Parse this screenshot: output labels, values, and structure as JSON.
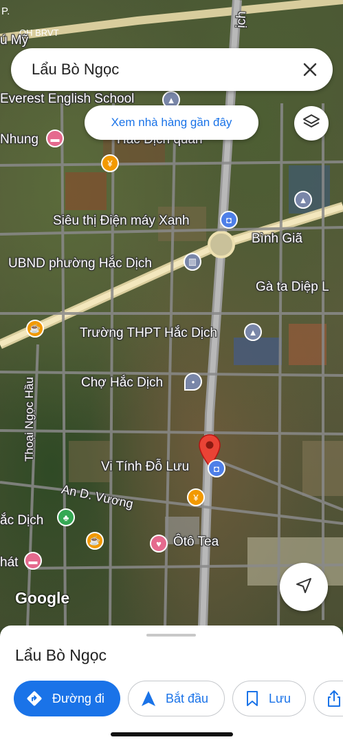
{
  "status": {
    "left_fragment": "P.",
    "carrier": "QH BRVT"
  },
  "search": {
    "value": "Lẩu Bò Ngọc"
  },
  "chip": {
    "label": "Xem nhà hàng gần đây"
  },
  "map_labels": {
    "top_left": "ú Mỹ",
    "everest": "Everest English School",
    "nhung": "Nhung",
    "hac_dich_quan": "Hắc Dịch quán",
    "sieu_thi": "Siêu thị Điện máy Xanh",
    "binh_gia": "Bình Giã",
    "ubnd": "UBND phường Hắc Dịch",
    "ga_ta": "Gà ta Diệp L",
    "truong": "Trường THPT Hắc Dịch",
    "cho": "Chợ Hắc Dịch",
    "thoai_ngoc_hau": "Thoại Ngọc Hầu",
    "vi_tinh": "Vi Tính Đỗ Lưu",
    "an_d_vuong": "An D. Vương",
    "hac_dich": "ắc Dịch",
    "oto_tea": "Ôtô Tea",
    "nhat": "hát",
    "road_top": "ịch",
    "google": "Google"
  },
  "sheet": {
    "title": "Lẩu Bò Ngọc",
    "buttons": {
      "directions": "Đường đi",
      "start": "Bắt đầu",
      "save": "Lưu"
    }
  },
  "icons": [
    "close-icon",
    "layers-icon",
    "location-arrow-icon",
    "directions-icon",
    "navigation-icon",
    "bookmark-icon",
    "share-icon"
  ],
  "colors": {
    "accent": "#1a73e8",
    "marker": "#ea4335"
  }
}
